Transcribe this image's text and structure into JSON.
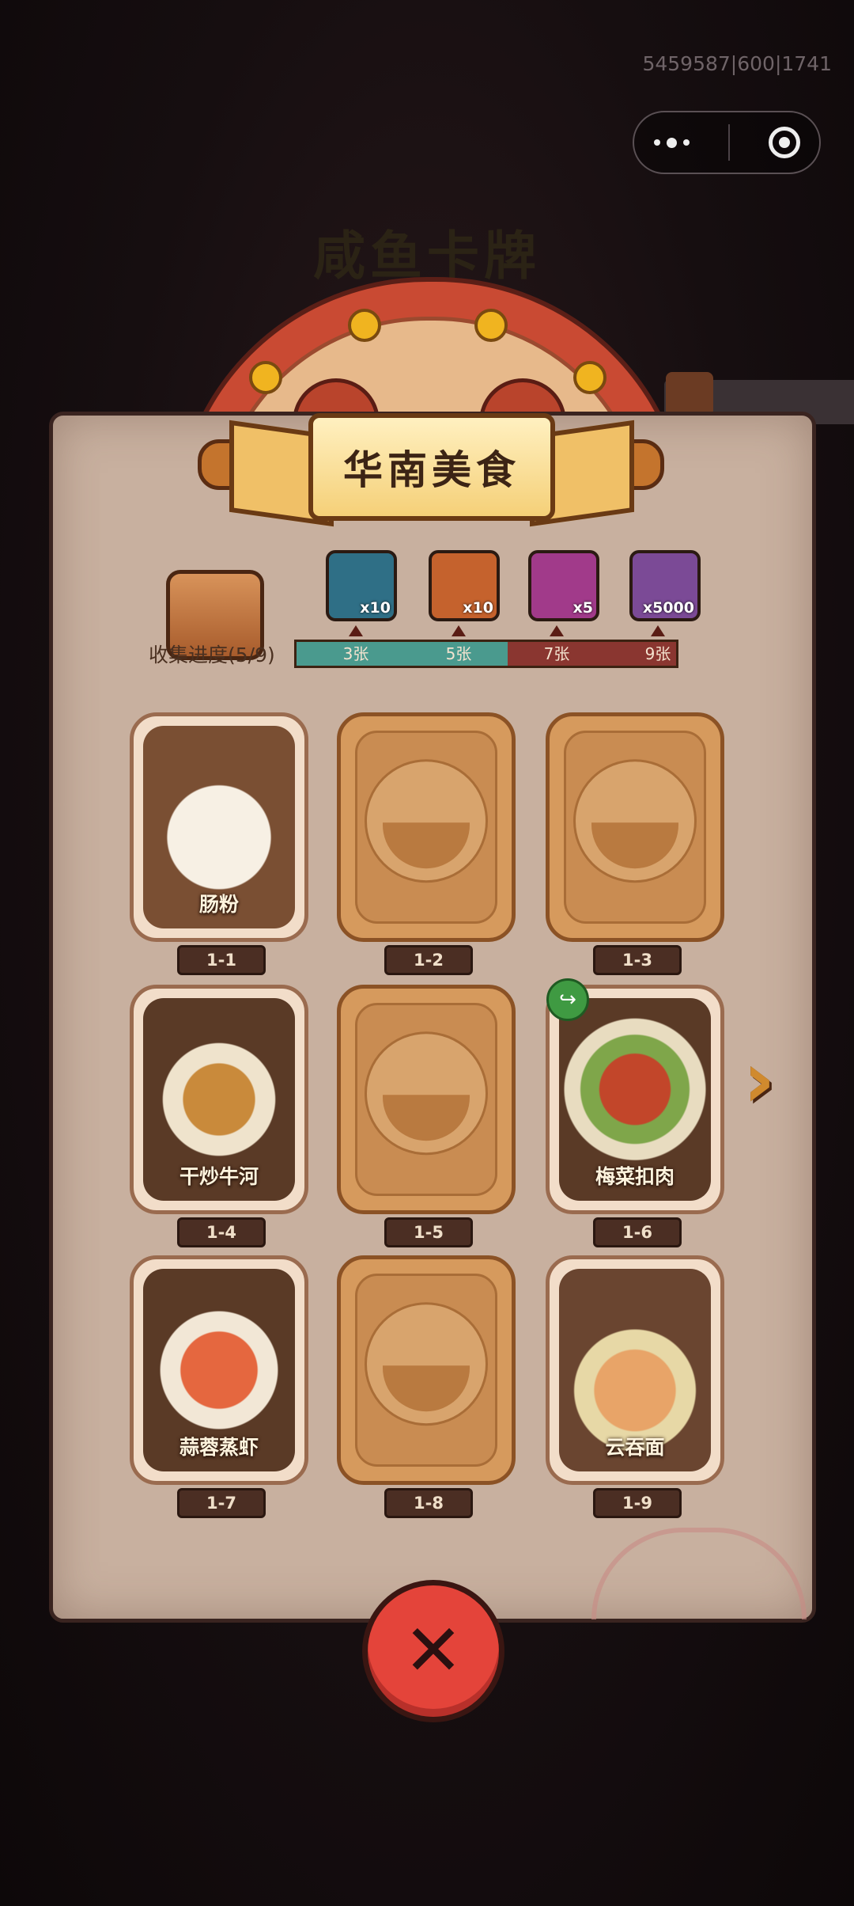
{
  "debug_id": "5459587|600|1741",
  "capsule": {
    "more_icon": "more-dots-icon",
    "close_icon": "target-icon"
  },
  "background_title": "咸鱼卡牌",
  "banner": {
    "title": "华南美食"
  },
  "collection": {
    "label": "收集进度(5/9)",
    "collected": 5,
    "total": 9,
    "rewards": [
      {
        "icon": "treasure-chest-icon",
        "count": "x10",
        "color": "#2f6f86",
        "milestone": "3张"
      },
      {
        "icon": "scroll-ticket-icon",
        "count": "x10",
        "color": "#c5622d",
        "milestone": "5张"
      },
      {
        "icon": "swirl-orb-icon",
        "count": "x5",
        "color": "#a13a8a",
        "milestone": "7张"
      },
      {
        "icon": "crystal-gem-icon",
        "count": "x5000",
        "color": "#7b4a96",
        "milestone": "9张"
      }
    ]
  },
  "cards": [
    {
      "id": "1-1",
      "name": "肠粉",
      "found": true
    },
    {
      "id": "1-2",
      "name": "",
      "found": false
    },
    {
      "id": "1-3",
      "name": "",
      "found": false
    },
    {
      "id": "1-4",
      "name": "干炒牛河",
      "found": true
    },
    {
      "id": "1-5",
      "name": "",
      "found": false
    },
    {
      "id": "1-6",
      "name": "梅菜扣肉",
      "found": true,
      "shareable": true
    },
    {
      "id": "1-7",
      "name": "蒜蓉蒸虾",
      "found": true
    },
    {
      "id": "1-8",
      "name": "",
      "found": false
    },
    {
      "id": "1-9",
      "name": "云吞面",
      "found": true
    }
  ],
  "colors": {
    "accent_red": "#e4443a",
    "progress_teal": "#4a9a8e",
    "progress_remaining": "#8a3630"
  }
}
